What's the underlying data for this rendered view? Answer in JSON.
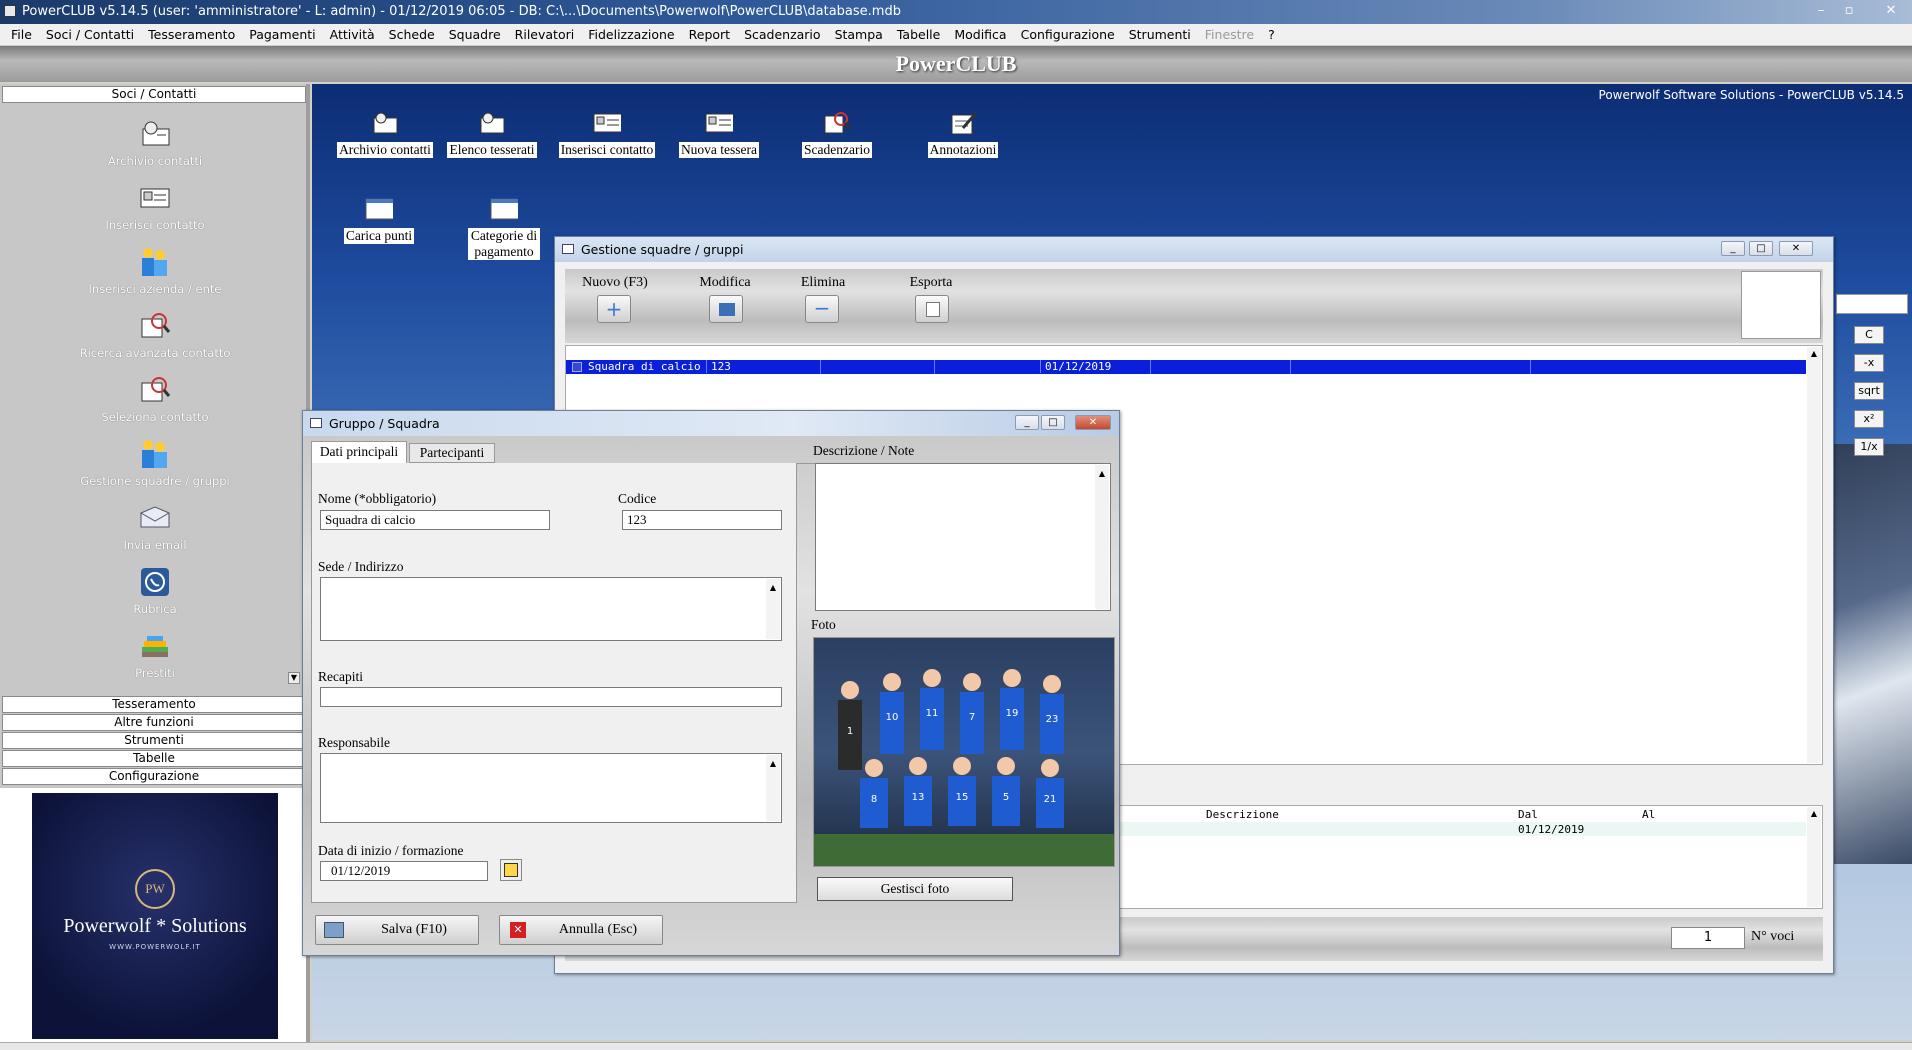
{
  "app": {
    "title": "PowerCLUB v5.14.5  (user: 'amministratore'  - L: admin) - 01/12/2019 06:05 - DB: C:\\...\\Documents\\Powerwolf\\PowerCLUB\\database.mdb",
    "banner": "PowerCLUB",
    "desktop_caption": "Powerwolf Software Solutions - PowerCLUB v5.14.5"
  },
  "menu": [
    "File",
    "Soci / Contatti",
    "Tesseramento",
    "Pagamenti",
    "Attività",
    "Schede",
    "Squadre",
    "Rilevatori",
    "Fidelizzazione",
    "Report",
    "Scadenzario",
    "Stampa",
    "Tabelle",
    "Modifica",
    "Configurazione",
    "Strumenti",
    "Finestre",
    "?"
  ],
  "sidebar": {
    "header": "Soci / Contatti",
    "items": [
      "Archivio contatti",
      "Inserisci contatto",
      "Inserisci azienda / ente",
      "Ricerca avanzata contatto",
      "Seleziona contatto",
      "Gestione squadre / gruppi",
      "Invia email",
      "Rubrica",
      "Prestiti"
    ],
    "sections": [
      "Tesseramento",
      "Altre funzioni",
      "Strumenti",
      "Tabelle",
      "Configurazione"
    ]
  },
  "logo": {
    "badge": "PW",
    "name": "Powerwolf * Solutions",
    "url": "WWW.POWERWOLF.IT"
  },
  "desktop_icons": [
    "Archivio contatti",
    "Elenco tesserati",
    "Inserisci contatto",
    "Nuova tessera",
    "Scadenzario",
    "Annotazioni",
    "Carica punti",
    "Categorie di pagamento"
  ],
  "gestione": {
    "title": "Gestione squadre / gruppi",
    "toolbar": [
      "Nuovo (F3)",
      "Modifica",
      "Elimina",
      "Esporta"
    ],
    "row": {
      "name": "Squadra di calcio",
      "code": "123",
      "date": "01/12/2019"
    },
    "sub_headers": [
      "Descrizione",
      "Dal",
      "Al"
    ],
    "sub_row_date": "01/12/2019",
    "count": "1",
    "count_label": "N° voci"
  },
  "calc": {
    "buttons": [
      "C",
      "-x",
      "sqrt",
      "x²",
      "1/x"
    ]
  },
  "gruppo": {
    "title": "Gruppo / Squadra",
    "tabs": [
      "Dati principali",
      "Partecipanti"
    ],
    "nome_label": "Nome (*obbligatorio)",
    "nome_value": "Squadra di calcio",
    "codice_label": "Codice",
    "codice_value": "123",
    "sede_label": "Sede / Indirizzo",
    "recapiti_label": "Recapiti",
    "responsabile_label": "Responsabile",
    "data_label": "Data di inizio / formazione",
    "data_value": "01/12/2019",
    "descr_label": "Descrizione / Note",
    "foto_label": "Foto",
    "photo_numbers": [
      "1",
      "10",
      "11",
      "7",
      "19",
      "23",
      "8",
      "13",
      "15",
      "5",
      "21"
    ],
    "gestisci_foto": "Gestisci foto",
    "salva": "Salva (F10)",
    "annulla": "Annulla (Esc)"
  }
}
